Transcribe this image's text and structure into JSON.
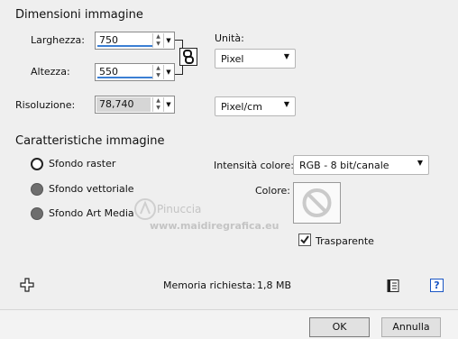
{
  "image_dimensions": {
    "title": "Dimensioni immagine",
    "width_label": "Larghezza:",
    "width_value": "750",
    "height_label": "Altezza:",
    "height_value": "550",
    "resolution_label": "Risoluzione:",
    "resolution_value": "78,740",
    "unit_label": "Unità:",
    "unit_value": "Pixel",
    "resolution_unit_value": "Pixel/cm"
  },
  "image_characteristics": {
    "title": "Caratteristiche immagine",
    "background_options": [
      {
        "label": "Sfondo raster",
        "underline_char": "S",
        "selected": true
      },
      {
        "label": "Sfondo vettoriale",
        "underline_char": "S",
        "selected": false
      },
      {
        "label": "Sfondo Art Media",
        "underline_char": "A",
        "selected": false
      }
    ],
    "color_depth_label": "Intensità colore:",
    "color_depth_value": "RGB - 8 bit/canale",
    "color_label": "Colore:",
    "transparent_label": "Trasparente",
    "transparent_checked": true
  },
  "footer": {
    "memory_label": "Memoria richiesta:",
    "memory_value": "1,8 MB",
    "ok_label": "OK",
    "cancel_label": "Annulla"
  },
  "watermark": {
    "name": "Pinuccia",
    "site": "www.maidiregrafica.eu"
  },
  "icons": {
    "link": "chain-link-icon",
    "plus": "plus-icon",
    "presets": "presets-icon",
    "help": "help-icon"
  },
  "colors": {
    "accent_blue": "#3b7fd4",
    "help_blue": "#1a56c4",
    "dialog_bg": "#efefef"
  }
}
